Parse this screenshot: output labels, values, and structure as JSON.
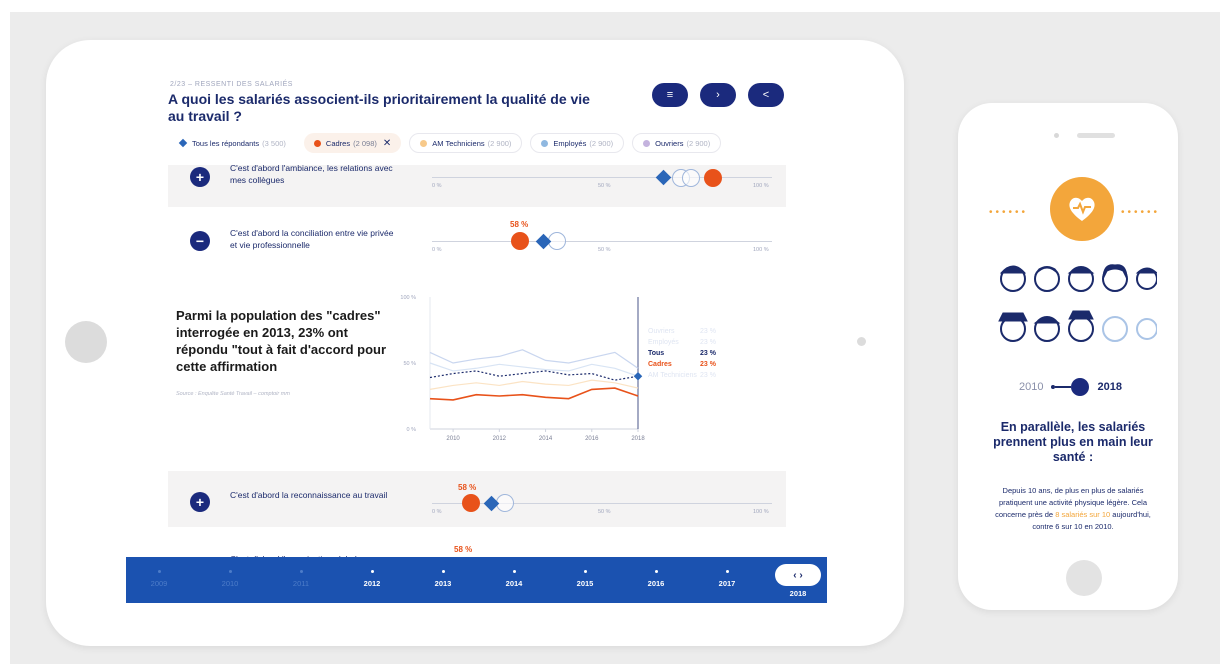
{
  "tablet": {
    "section_label": "2/23 – RESSENTI DES SALARIÉS",
    "title": "A quoi les salariés associent-ils prioritairement la qualité de vie au travail ?",
    "buttons": {
      "menu": "≡",
      "next": "›",
      "share": "<"
    },
    "filters": [
      {
        "label": "Tous les répondants",
        "count": "(3 500)",
        "color": "#2a66b8",
        "shape": "diamond",
        "selected": false
      },
      {
        "label": "Cadres",
        "count": "(2 098)",
        "color": "#e8521a",
        "shape": "dot",
        "selected": true,
        "close": "✕"
      },
      {
        "label": "AM Techniciens",
        "count": "(2 900)",
        "color": "#f7c98a",
        "shape": "dot",
        "selected": false
      },
      {
        "label": "Employés",
        "count": "(2 900)",
        "color": "#8fb8e0",
        "shape": "dot",
        "selected": false
      },
      {
        "label": "Ouvriers",
        "count": "(2 900)",
        "color": "#c4b3de",
        "shape": "dot",
        "selected": false
      }
    ],
    "rows": [
      {
        "text": "C'est d'abord l'ambiance, les relations avec mes collègues",
        "toggle": "+",
        "ticks": [
          "0 %",
          "50 %",
          "100 %"
        ]
      },
      {
        "text": "C'est d'abord la conciliation entre vie privée et vie professionnelle",
        "toggle": "−",
        "pct": "58 %",
        "ticks": [
          "0 %",
          "50 %",
          "100 %"
        ]
      },
      {
        "text": "C'est d'abord la reconnaissance au travail",
        "toggle": "+",
        "pct": "58 %",
        "ticks": [
          "0 %",
          "50 %",
          "100 %"
        ]
      },
      {
        "text": "C'est d'abord l'organisation globale",
        "toggle": "+",
        "pct": "58 %"
      }
    ],
    "insight": "Parmi la population des \"cadres\" interrogée en 2013, 23% ont répondu \"tout à fait d'accord pour cette affirmation",
    "source": "Source : Enquête Santé Travail – comptoir mm",
    "timeline": {
      "years": [
        "2009",
        "2010",
        "2011",
        "2012",
        "2013",
        "2014",
        "2015",
        "2016",
        "2017",
        "2018"
      ],
      "active_from": "2012",
      "selected": "2018",
      "nav": "‹ ›"
    }
  },
  "chart_data": {
    "type": "line",
    "x": [
      2009,
      2010,
      2011,
      2012,
      2013,
      2014,
      2015,
      2016,
      2017,
      2018
    ],
    "xticks": [
      "2010",
      "2012",
      "2014",
      "2016",
      "2018"
    ],
    "yticks": [
      "100 %",
      "50 %",
      "0 %"
    ],
    "ylim": [
      0,
      100
    ],
    "series": [
      {
        "name": "Ouvriers",
        "value_label": "23 %",
        "color": "#c9d6ef",
        "values": [
          58,
          50,
          53,
          55,
          60,
          52,
          50,
          54,
          58,
          46
        ]
      },
      {
        "name": "Employés",
        "value_label": "23 %",
        "color": "#d8e4f4",
        "values": [
          50,
          44,
          46,
          49,
          47,
          45,
          44,
          49,
          46,
          40
        ]
      },
      {
        "name": "Tous",
        "value_label": "23 %",
        "color": "#1b2a6b",
        "values": [
          39,
          42,
          44,
          40,
          42,
          44,
          41,
          42,
          37,
          40
        ],
        "dashed": true
      },
      {
        "name": "Cadres",
        "value_label": "23 %",
        "color": "#e8521a",
        "values": [
          23,
          22,
          26,
          25,
          26,
          24,
          23,
          30,
          31,
          25
        ]
      },
      {
        "name": "AM Techniciens",
        "value_label": "23 %",
        "color": "#fbe3c4",
        "values": [
          30,
          33,
          35,
          33,
          36,
          34,
          33,
          37,
          35,
          31
        ]
      }
    ]
  },
  "phone": {
    "year_from": "2010",
    "year_to": "2018",
    "heading": "En parallèle, les salariés prennent plus en main leur santé :",
    "body_start": "Depuis 10 ans, de plus en plus de salariés pratiquent une activité physique légère. Cela concerne près de ",
    "body_highlight": "8 salariés sur 10",
    "body_end": " aujourd'hui, contre 6 sur 10 en 2010.",
    "accent": "#f3a63b"
  }
}
